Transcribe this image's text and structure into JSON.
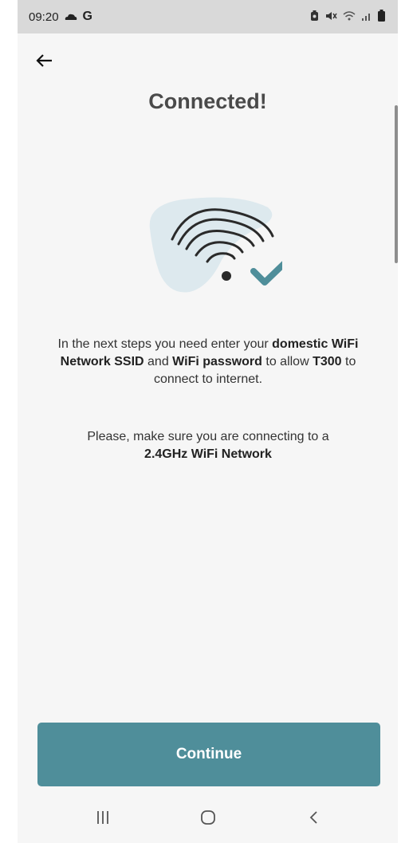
{
  "status_bar": {
    "time": "09:20",
    "letter": "G"
  },
  "title": "Connected!",
  "para1": {
    "a": "In the next steps you need enter your ",
    "b": "domestic WiFi Network SSID",
    "c": " and ",
    "d": "WiFi password",
    "e": " to allow ",
    "f": "T300",
    "g": " to connect to internet."
  },
  "para2": {
    "a": "Please, make sure you are connecting to a ",
    "b": "2.4GHz WiFi Network"
  },
  "button": {
    "label": "Continue"
  },
  "colors": {
    "accent": "#4f8e9a",
    "blob": "#dde9ee",
    "check": "#4f8e9a"
  },
  "icons": [
    "cloud-icon",
    "battery-saver-icon",
    "mute-icon",
    "wifi-status-icon",
    "signal-icon",
    "battery-icon",
    "back-arrow-icon",
    "wifi-connected-illustration",
    "recents-icon",
    "home-icon",
    "nav-back-icon"
  ]
}
